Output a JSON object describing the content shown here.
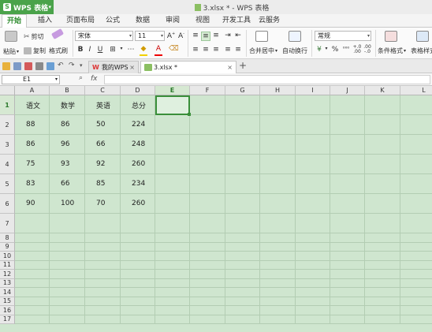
{
  "app": {
    "name": "WPS 表格",
    "window_title": "3.xlsx * - WPS 表格"
  },
  "ribbon_tabs": [
    "开始",
    "插入",
    "页面布局",
    "公式",
    "数据",
    "审阅",
    "视图",
    "开发工具",
    "云服务"
  ],
  "active_tab": "开始",
  "ribbon": {
    "paste": "粘贴",
    "cut": "剪切",
    "copy": "复制",
    "format_painter": "格式刷",
    "font_name": "宋体",
    "font_size": "11",
    "merge_center": "合并居中",
    "wrap_text": "自动换行",
    "number_format": "常规",
    "cond_format": "条件格式",
    "table_style": "表格样式"
  },
  "doc_tabs": [
    {
      "label": "我的WPS",
      "active": false
    },
    {
      "label": "3.xlsx *",
      "active": true
    }
  ],
  "formula_bar": {
    "name_box": "E1",
    "fx": "fx",
    "content": ""
  },
  "columns": [
    "A",
    "B",
    "C",
    "D",
    "E",
    "F",
    "G",
    "H",
    "I",
    "J",
    "K",
    "L"
  ],
  "selected_column": "E",
  "rows": [
    "1",
    "2",
    "3",
    "4",
    "5",
    "6",
    "7",
    "8",
    "9",
    "10",
    "11",
    "12",
    "13",
    "14",
    "15",
    "16",
    "17"
  ],
  "selected_row": "1",
  "table": {
    "headers": [
      "语文",
      "数学",
      "英语",
      "总分"
    ],
    "data": [
      [
        "88",
        "86",
        "50",
        "224"
      ],
      [
        "86",
        "96",
        "66",
        "248"
      ],
      [
        "75",
        "93",
        "92",
        "260"
      ],
      [
        "83",
        "66",
        "85",
        "234"
      ],
      [
        "90",
        "100",
        "70",
        "260"
      ]
    ]
  },
  "colors": {
    "accent": "#4aa34a",
    "cell_bg": "#cfe6cf",
    "active_border": "#3a8f3a"
  }
}
